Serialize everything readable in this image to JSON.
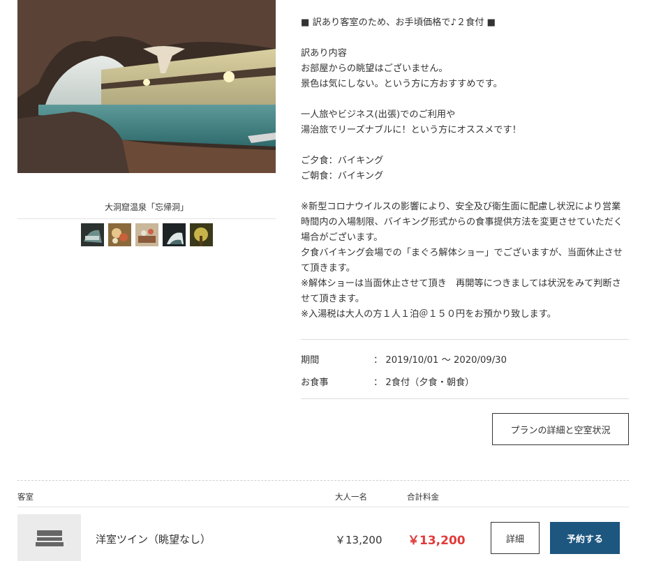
{
  "gallery": {
    "caption": "大洞窟温泉「忘帰洞」",
    "thumbnails": [
      "cave-bath",
      "food-platter",
      "dining",
      "cave-view",
      "forest"
    ]
  },
  "description": {
    "lines": [
      "■ 訳あり客室のため、お手頃価格で♪２食付 ■",
      "",
      "訳あり内容",
      "お部屋からの眺望はございません。",
      "景色は気にしない。という方に方おすすめです。",
      "",
      "一人旅やビジネス(出張)でのご利用や",
      "湯治旅でリーズナブルに！という方にオススメです！",
      "",
      "ご夕食：バイキング",
      "ご朝食：バイキング",
      "",
      "※新型コロナウイルスの影響により、安全及び衛生面に配慮し状況により営業時間内の入場制限、バイキング形式からの食事提供方法を変更させていただく場合がございます。",
      "夕食バイキング会場での「まぐろ解体ショー」でございますが、当面休止させて頂きます。",
      "※解体ショーは当面休止させて頂き　再開等につきましては状況をみて判断させて頂きます。",
      "※入湯税は大人の方１人１泊＠１５０円をお預かり致します。"
    ]
  },
  "info": {
    "period_label": "期間",
    "period_value": "： 2019/10/01 ～ 2020/09/30",
    "meal_label": "お食事",
    "meal_value": "： 2食付（夕食・朝食）"
  },
  "plan_button": "プランの詳細と空室状況",
  "room_table": {
    "col_room": "客室",
    "col_adult": "大人一名",
    "col_total": "合計料金",
    "rows": [
      {
        "name": "洋室ツイン（眺望なし）",
        "price": "￥13,200",
        "total": "￥13,200",
        "detail_label": "詳細",
        "reserve_label": "予約する"
      }
    ]
  },
  "colors": {
    "accent_blue": "#1d567f",
    "price_red": "#e03a3a"
  }
}
